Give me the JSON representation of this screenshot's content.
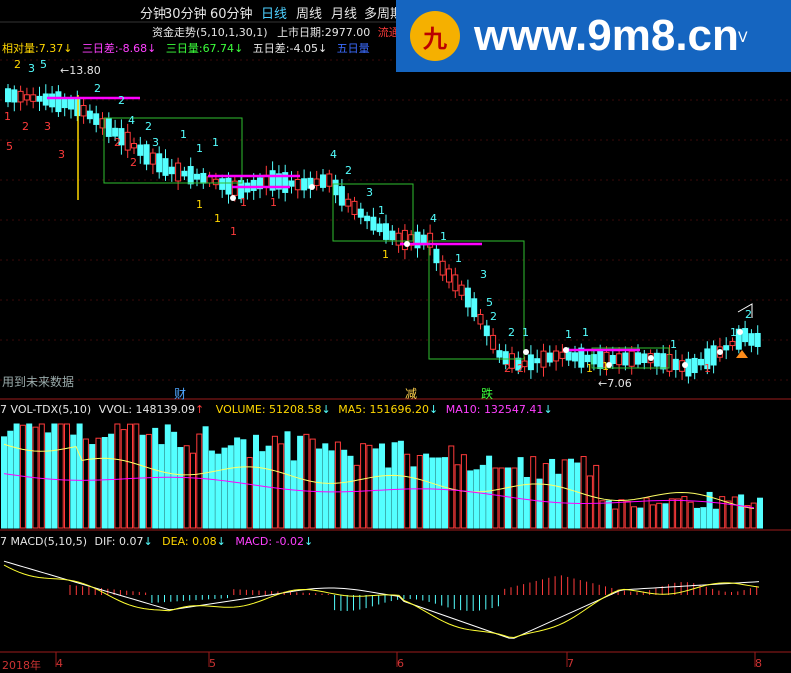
{
  "toolbar": {
    "timeframes": [
      "分钟",
      "30分钟",
      "60分钟",
      "日线",
      "周线",
      "月线",
      "多周期"
    ],
    "active": "日线"
  },
  "main_legend": {
    "rel_volume_label": "相对量:",
    "rel_volume_value": "7.37",
    "rel_volume_arrow": "↓",
    "three_day_diff_label": "三日差:",
    "three_day_diff_value": "-8.68",
    "three_day_diff_arrow": "↓",
    "three_day_vol_label": "三日量:",
    "three_day_vol_value": "67.74",
    "three_day_vol_arrow": "↓",
    "five_day_diff_label": "五日差:",
    "five_day_diff_value": "-4.05",
    "five_day_diff_arrow": "↓",
    "five_day_vol_label": "五日量",
    "fund_trend": "资金走势(5,10,1,30,1)",
    "listing_date_label": "上市日期:",
    "listing_date_value": "2977.00",
    "circulation_label": "流通"
  },
  "main_chart": {
    "high_marker": "←13.80",
    "low_marker": "←7.06",
    "future_data_notice": "用到未来数据",
    "events": [
      "财",
      "减",
      "跌"
    ]
  },
  "watermark": {
    "text": "www.9m8.cn",
    "logo_glyph": "九",
    "corner_mark": "V"
  },
  "volume_panel": {
    "title": "7 VOL-TDX(5,10)",
    "vvol_label": "VVOL:",
    "vvol_value": "148139.09",
    "vvol_arrow": "↑",
    "volume_label": "VOLUME:",
    "volume_value": "51208.58",
    "volume_arrow": "↓",
    "ma5_label": "MA5:",
    "ma5_value": "151696.20",
    "ma5_arrow": "↓",
    "ma10_label": "MA10:",
    "ma10_value": "132547.41",
    "ma10_arrow": "↓"
  },
  "macd_panel": {
    "title": "7 MACD(5,10,5)",
    "dif_label": "DIF:",
    "dif_value": "0.07",
    "dif_arrow": "↓",
    "dea_label": "DEA:",
    "dea_value": "0.08",
    "dea_arrow": "↓",
    "macd_label": "MACD:",
    "macd_value": "-0.02",
    "macd_arrow": "↓"
  },
  "time_axis": {
    "labels": [
      "2018年",
      "4",
      "5",
      "6",
      "7",
      "8"
    ]
  },
  "colors": {
    "up": "#ff3b3b",
    "down": "#54ffff",
    "box": "#2fbf2f",
    "ma_magenta": "#ff00ff",
    "ma_yellow": "#ffff00",
    "grid_red": "#9b1b1b",
    "watermark_bg": "#1565c0"
  },
  "chart_data": {
    "type": "table",
    "price_extremes": {
      "high": 13.8,
      "low": 7.06
    },
    "volume": {
      "VVOL": 148139.09,
      "VOLUME": 51208.58,
      "MA5": 151696.2,
      "MA10": 132547.41
    },
    "macd": {
      "DIF": 0.07,
      "DEA": 0.08,
      "MACD": -0.02
    }
  }
}
